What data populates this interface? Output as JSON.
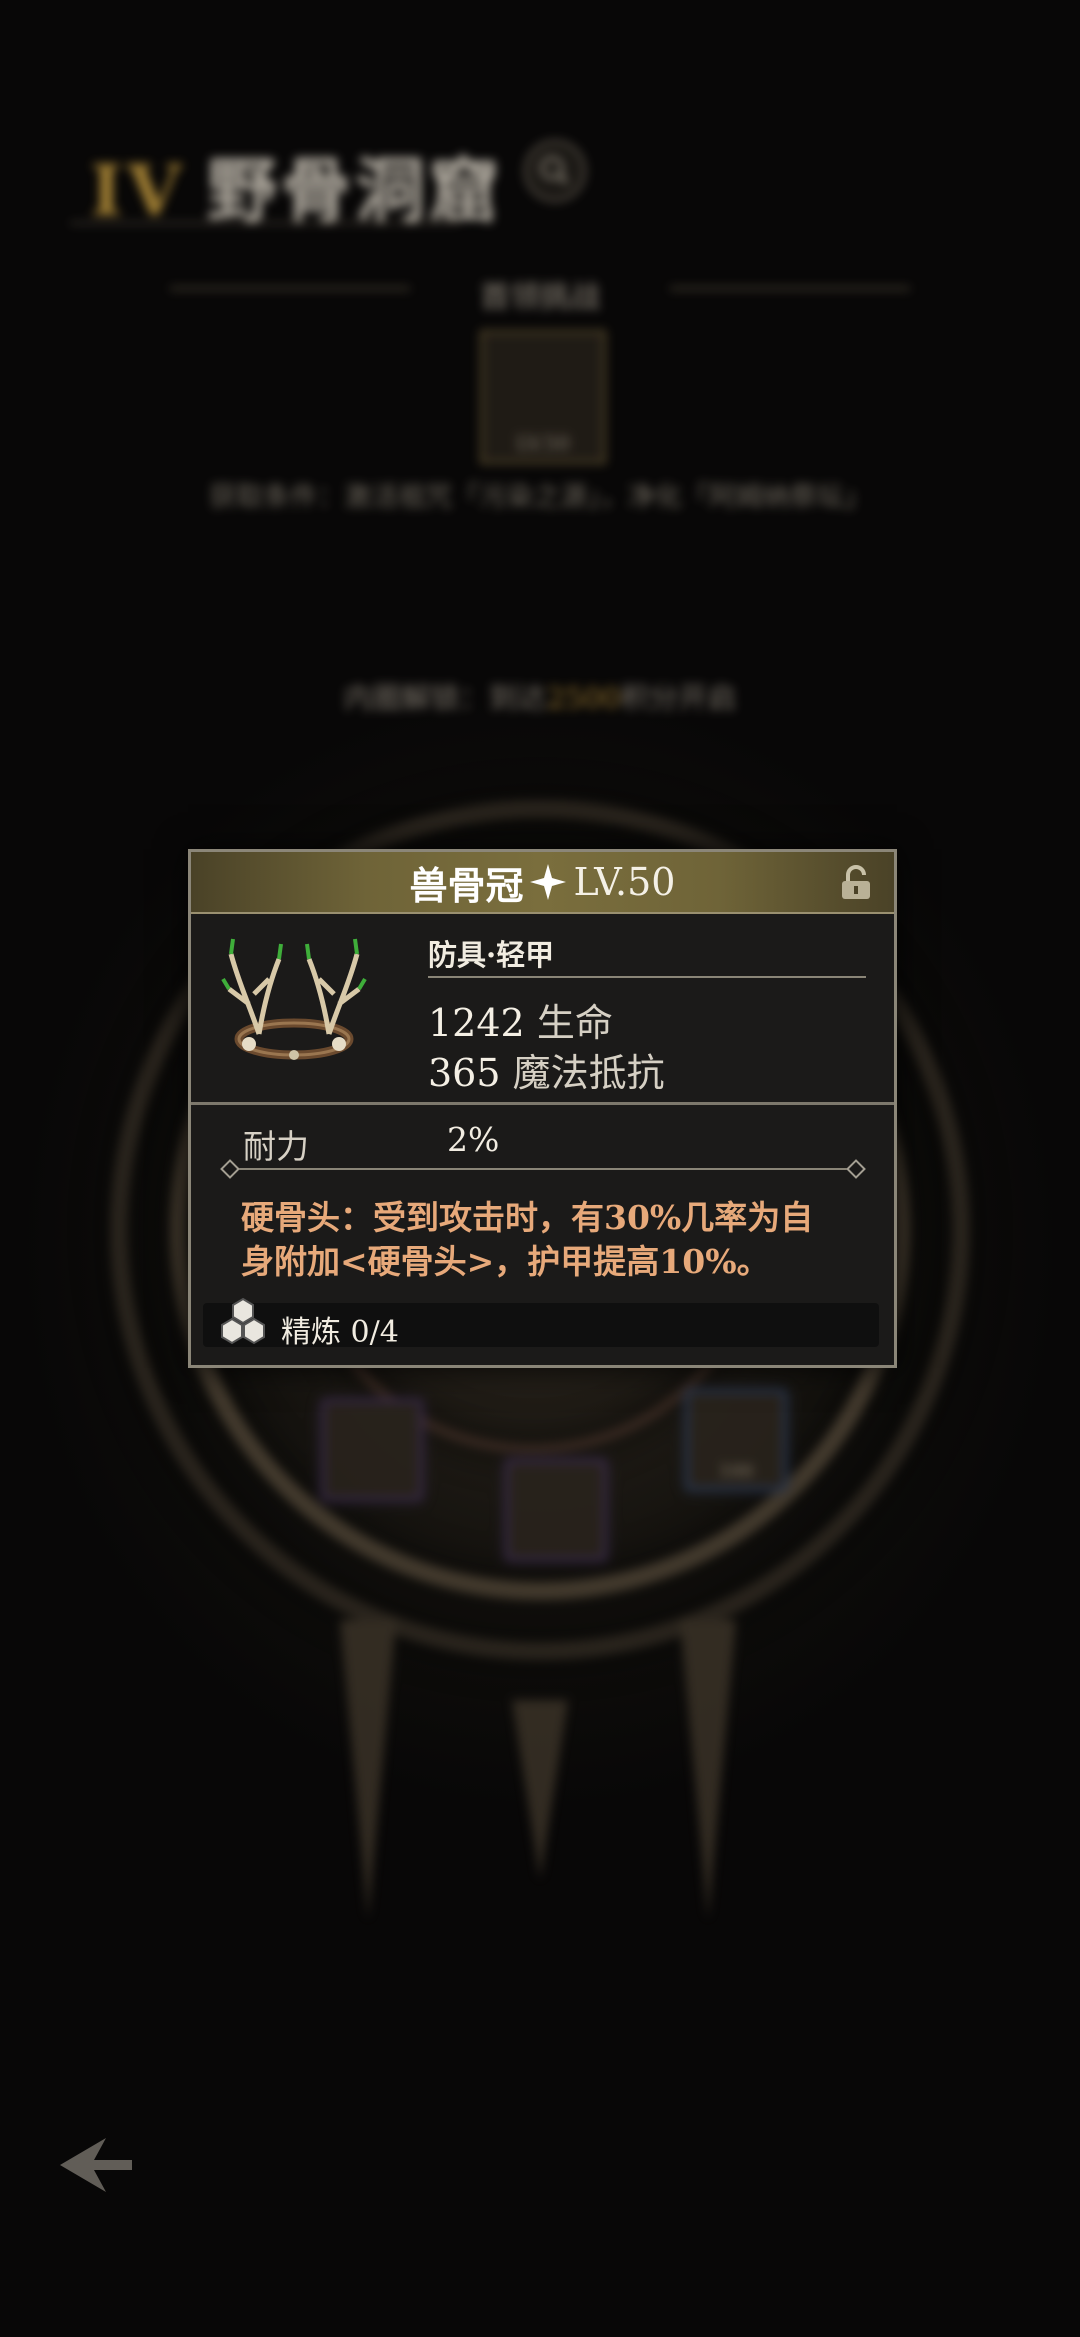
{
  "zone": {
    "numeral": "IV",
    "name": "野骨洞窟"
  },
  "boss": {
    "header": "首领挑战",
    "icon_level": "LV.50",
    "unlock_condition": "获取条件：激活祖咒「污染之源」，净化「阿姆纳祭坛」"
  },
  "inner_ring": {
    "prefix": "内圈解锁：到达",
    "points": "2500",
    "suffix": "积分开启"
  },
  "reward_slots": {
    "gold_amount": "100"
  },
  "item": {
    "name": "兽骨冠",
    "level": "LV.50",
    "type": "防具·轻甲",
    "stats": [
      {
        "value": "1242",
        "label": "生命"
      },
      {
        "value": "365",
        "label": "魔法抵抗"
      }
    ],
    "durability_label": "耐力",
    "durability_value": "2%",
    "effect": "硬骨头：受到攻击时，有30%几率为自身附加<硬骨头>，护甲提高10%。",
    "refine_label": "精炼",
    "refine_value": "0/4",
    "colors": {
      "header": "#7a6e3d",
      "effect_text": "#e7a97a",
      "frame": "#8b8678"
    }
  },
  "icons": [
    "search-icon",
    "lock-icon",
    "sparkle-icon",
    "refine-icon",
    "back-icon"
  ]
}
